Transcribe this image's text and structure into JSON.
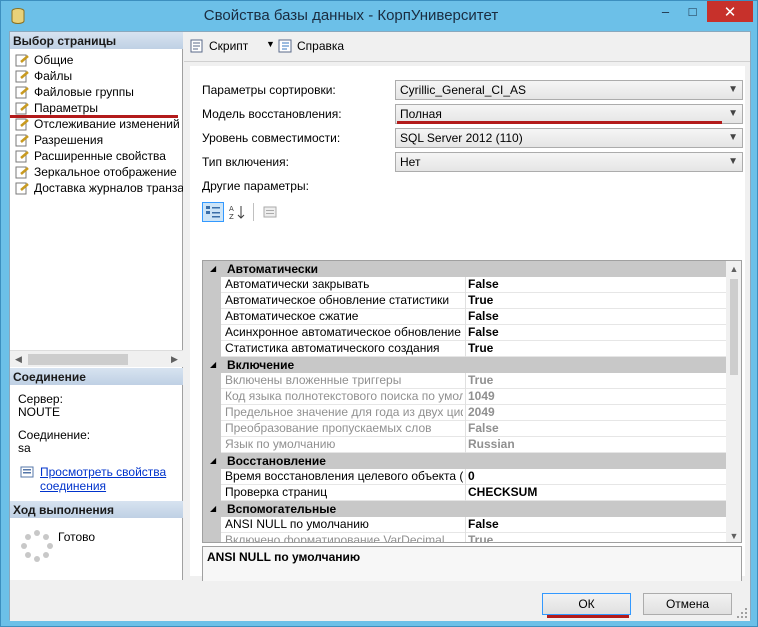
{
  "window": {
    "title": "Свойства базы данных - КорпУниверситет"
  },
  "controls": {
    "minimize": "–",
    "maximize": "□",
    "close": "✕"
  },
  "left": {
    "select_page_header": "Выбор страницы",
    "pages": [
      {
        "label": "Общие"
      },
      {
        "label": "Файлы"
      },
      {
        "label": "Файловые группы"
      },
      {
        "label": "Параметры"
      },
      {
        "label": "Отслеживание изменений"
      },
      {
        "label": "Разрешения"
      },
      {
        "label": "Расширенные свойства"
      },
      {
        "label": "Зеркальное отображение"
      },
      {
        "label": "Доставка журналов транзакций"
      }
    ],
    "connection_header": "Соединение",
    "server_label": "Сервер:",
    "server_value": "NOUTE",
    "connection_label": "Соединение:",
    "connection_value": "sa",
    "view_link_line1": "Просмотреть свойства",
    "view_link_line2": "соединения",
    "progress_header": "Ход выполнения",
    "progress_status": "Готово"
  },
  "toolbar": {
    "script_label": "Скрипт",
    "help_label": "Справка"
  },
  "options": {
    "collation_label": "Параметры сортировки:",
    "collation_value": "Cyrillic_General_CI_AS",
    "recovery_label": "Модель восстановления:",
    "recovery_value": "Полная",
    "compat_label": "Уровень совместимости:",
    "compat_value": "SQL Server 2012 (110)",
    "containment_label": "Тип включения:",
    "containment_value": "Нет",
    "other_label": "Другие параметры:"
  },
  "grid": {
    "categories": [
      {
        "name": "Автоматически",
        "rows": [
          {
            "name": "Автоматически закрывать",
            "value": "False"
          },
          {
            "name": "Автоматическое обновление статистики",
            "value": "True"
          },
          {
            "name": "Автоматическое сжатие",
            "value": "False"
          },
          {
            "name": "Асинхронное автоматическое обновление ста",
            "value": "False"
          },
          {
            "name": "Статистика автоматического создания",
            "value": "True"
          }
        ]
      },
      {
        "name": "Включение",
        "rows": [
          {
            "name": "Включены вложенные триггеры",
            "value": "True"
          },
          {
            "name": "Код языка полнотекстового поиска по умолча",
            "value": "1049"
          },
          {
            "name": "Предельное значение для года из двух цифр",
            "value": "2049"
          },
          {
            "name": "Преобразование пропускаемых слов",
            "value": "False"
          },
          {
            "name": "Язык по умолчанию",
            "value": "Russian"
          }
        ]
      },
      {
        "name": "Восстановление",
        "rows": [
          {
            "name": "Время восстановления целевого объекта (в с",
            "value": "0"
          },
          {
            "name": "Проверка страниц",
            "value": "CHECKSUM"
          }
        ]
      },
      {
        "name": "Вспомогательные",
        "rows": [
          {
            "name": "ANSI NULL по умолчанию",
            "value": "False"
          },
          {
            "name": "Включено форматирование VarDecimal",
            "value": "True"
          }
        ]
      }
    ],
    "description": "ANSI NULL по умолчанию"
  },
  "buttons": {
    "ok": "ОК",
    "cancel": "Отмена"
  },
  "colors": {
    "accent_red": "#b31b1b",
    "title_bar": "#6cc0e8",
    "close_button": "#c7312b"
  }
}
